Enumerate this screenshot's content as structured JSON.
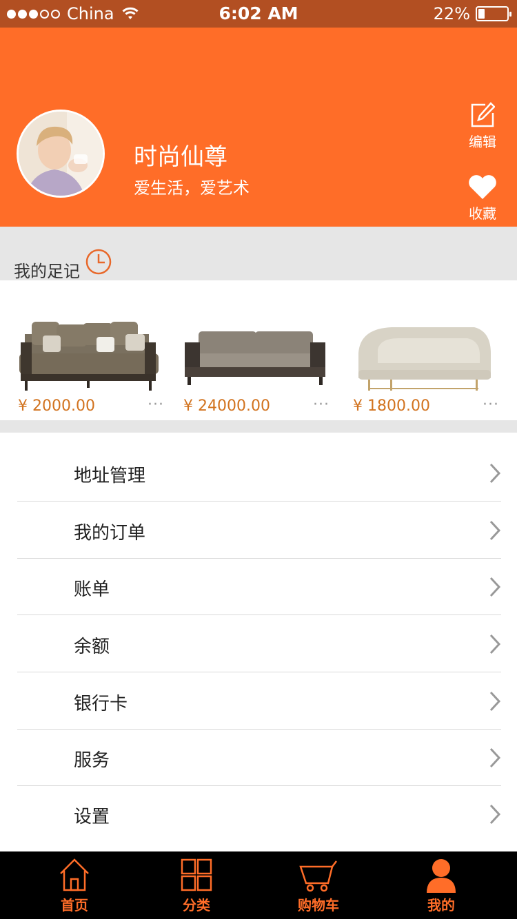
{
  "status_bar": {
    "carrier": "China",
    "time": "6:02 AM",
    "battery": "22%",
    "battery_level": 0.22
  },
  "profile": {
    "name": "时尚仙尊",
    "motto": "爱生活，爱艺术"
  },
  "header_actions": {
    "edit_label": "编辑",
    "favorite_label": "收藏"
  },
  "footprint": {
    "title": "我的足记",
    "products": [
      {
        "price": "¥ 2000.00",
        "more": "···",
        "image": "sofa-taupe-cushions"
      },
      {
        "price": "¥ 24000.00",
        "more": "···",
        "image": "sofa-grey-dark-frame"
      },
      {
        "price": "¥ 1800.00",
        "more": "···",
        "image": "sofa-beige-curved"
      }
    ]
  },
  "menu": [
    {
      "label": "地址管理"
    },
    {
      "label": "我的订单"
    },
    {
      "label": "账单"
    },
    {
      "label": "余额"
    },
    {
      "label": "银行卡"
    },
    {
      "label": "服务"
    },
    {
      "label": "设置"
    }
  ],
  "tabs": [
    {
      "label": "首页",
      "icon": "home-icon"
    },
    {
      "label": "分类",
      "icon": "grid-icon"
    },
    {
      "label": "购物车",
      "icon": "cart-icon"
    },
    {
      "label": "我的",
      "icon": "user-icon",
      "active": true
    }
  ],
  "colors": {
    "accent": "#ff6d28",
    "status_bar": "#b24f22",
    "price": "#d2731f",
    "tab_bar_bg": "#000000"
  }
}
